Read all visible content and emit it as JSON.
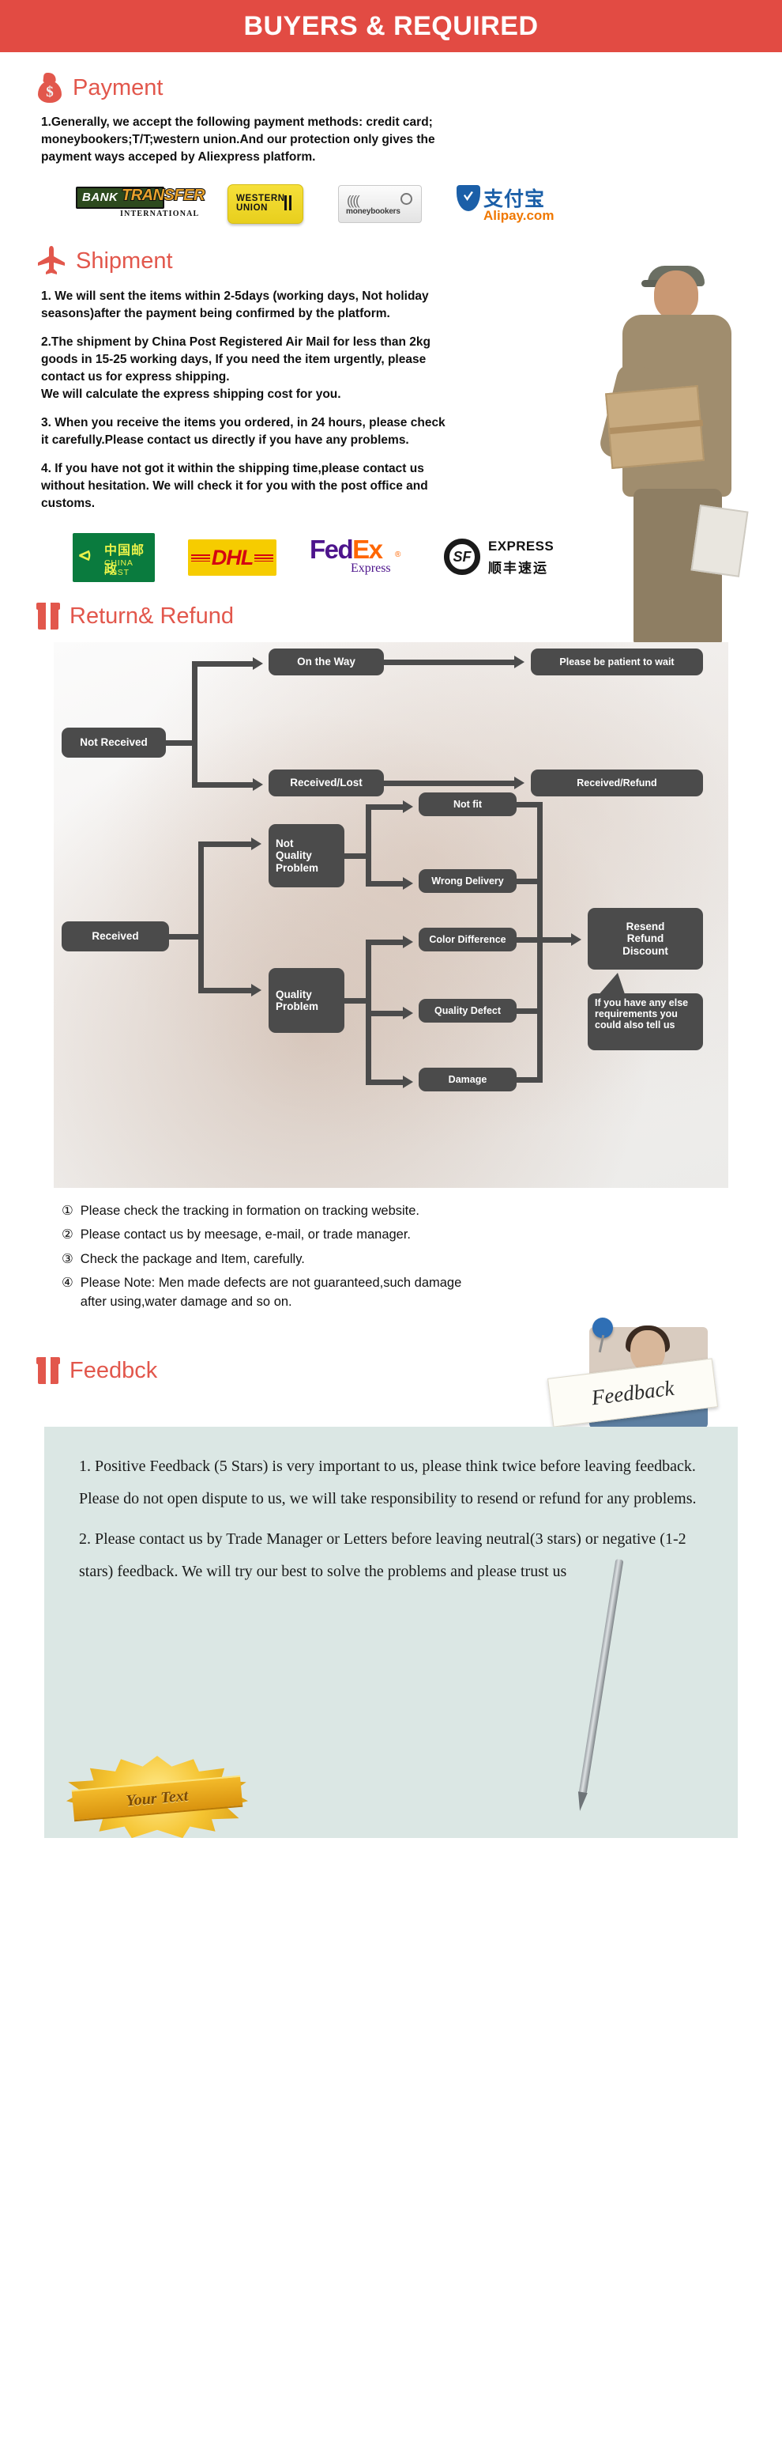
{
  "header": {
    "title": "BUYERS & REQUIRED",
    "bg": "#e24b43"
  },
  "accent": "#e2574c",
  "payment": {
    "heading": "Payment",
    "icon": "money-bag-icon",
    "body": "1.Generally, we accept the following payment methods: credit card;\nmoneybookers;T/T;western union.And our protection only gives the\npayment ways acceped by Aliexpress platform.",
    "logos": [
      {
        "name": "bank-transfer-logo",
        "bank": "BANK",
        "transfer": "TRANSFER",
        "sub": "INTERNATIONAL"
      },
      {
        "name": "western-union-logo",
        "line1": "WESTERN",
        "line2": "UNION"
      },
      {
        "name": "moneybookers-logo",
        "label": "moneybookers"
      },
      {
        "name": "alipay-logo",
        "zh": "支付宝",
        "en": "Alipay.com"
      }
    ]
  },
  "shipment": {
    "heading": "Shipment",
    "icon": "airplane-icon",
    "p1": "1. We will sent the items within 2-5days (working days, Not holiday\nseasons)after the payment being confirmed by the platform.",
    "p2": "2.The shipment by China Post Registered Air Mail for less than  2kg\ngoods in 15-25 working days, If  you need the item urgently, please\ncontact us for express shipping.\nWe will calculate the express shipping cost for you.",
    "p3": "3. When you receive the items you ordered, in 24 hours, please check\n it carefully.Please contact us directly if you have any problems.",
    "p4": "4. If you have not got it within the shipping time,please contact us\nwithout hesitation. We will check it for you with the post office and\ncustoms.",
    "logos": [
      {
        "name": "china-post-logo",
        "zh": "中国邮政",
        "en": "CHINA POST"
      },
      {
        "name": "dhl-logo",
        "label": "DHL"
      },
      {
        "name": "fedex-logo",
        "fed": "Fed",
        "ex": "Ex",
        "sub": "Express",
        "reg": "®"
      },
      {
        "name": "sf-express-logo",
        "mark": "SF",
        "en": "EXPRESS",
        "zh": "顺丰速运"
      }
    ]
  },
  "returns": {
    "heading": "Return& Refund",
    "icon": "gift-box-icon",
    "flow": {
      "not_received": "Not Received",
      "on_the_way": "On the Way",
      "received_lost": "Received/Lost",
      "please_wait": "Please be patient to wait",
      "received_refund": "Received/Refund",
      "received": "Received",
      "not_quality_problem": "Not\nQuality\nProblem",
      "quality_problem": "Quality\nProblem",
      "not_fit": "Not fit",
      "wrong_delivery": "Wrong Delivery",
      "color_difference": "Color Difference",
      "quality_defect": "Quality Defect",
      "damage": "Damage",
      "resend": "Resend\nRefund\nDiscount",
      "callout": "If you have any else\nrequirements you\ncould also tell us"
    },
    "notes": [
      {
        "num": "①",
        "text": "Please check the tracking in formation on tracking website."
      },
      {
        "num": "②",
        "text": "Please contact us by meesage, e-mail, or trade manager."
      },
      {
        "num": "③",
        "text": "Check the package and Item, carefully."
      },
      {
        "num": "④",
        "text": "Please Note: Men made defects  are not guaranteed,such damage\n   after using,water damage and so on."
      }
    ]
  },
  "feedback": {
    "heading": "Feedbck",
    "icon": "gift-box-icon",
    "photo_sign": "Feedback",
    "p1": "1. Positive Feedback (5 Stars) is very important to us, please think twice before leaving feedback. Please do not open dispute to us,   we will take responsibility to resend or refund for any problems.",
    "p2": "2. Please contact us by Trade Manager or Letters before leaving neutral(3 stars) or negative (1-2 stars) feedback. We will try our best to solve the problems and please trust us",
    "badge_text": "Your Text"
  }
}
